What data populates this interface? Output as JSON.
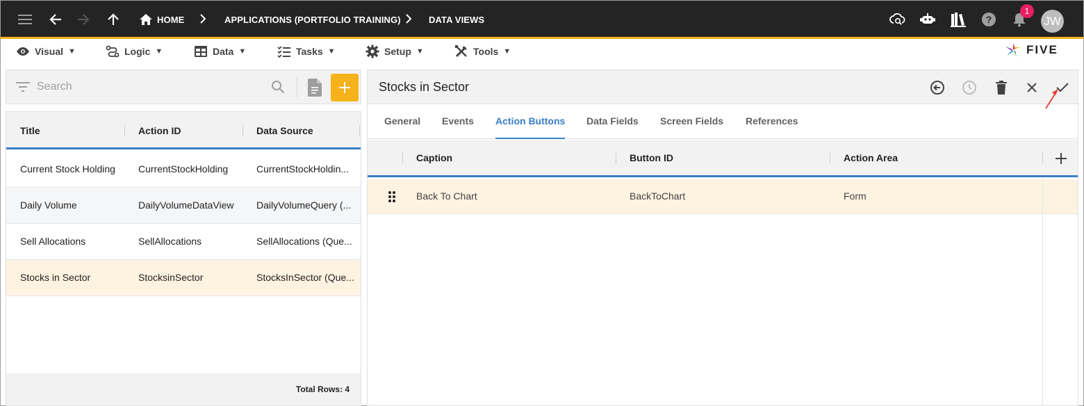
{
  "topbar": {
    "breadcrumbs": [
      "HOME",
      "APPLICATIONS (PORTFOLIO TRAINING)",
      "DATA VIEWS"
    ],
    "notification_count": "1",
    "avatar_initials": "JW"
  },
  "menu": {
    "items": [
      {
        "label": "Visual",
        "icon": "eye-icon"
      },
      {
        "label": "Logic",
        "icon": "logic-icon"
      },
      {
        "label": "Data",
        "icon": "table-icon"
      },
      {
        "label": "Tasks",
        "icon": "tasks-icon"
      },
      {
        "label": "Setup",
        "icon": "gear-icon"
      },
      {
        "label": "Tools",
        "icon": "tools-icon"
      }
    ],
    "logo_text": "FIVE"
  },
  "left": {
    "search_placeholder": "Search",
    "columns": [
      "Title",
      "Action ID",
      "Data Source"
    ],
    "rows": [
      {
        "title": "Current Stock Holding",
        "action_id": "CurrentStockHolding",
        "data_source": "CurrentStockHoldin..."
      },
      {
        "title": "Daily Volume",
        "action_id": "DailyVolumeDataView",
        "data_source": "DailyVolumeQuery (..."
      },
      {
        "title": "Sell Allocations",
        "action_id": "SellAllocations",
        "data_source": "SellAllocations (Que..."
      },
      {
        "title": "Stocks in Sector",
        "action_id": "StocksinSector",
        "data_source": "StocksInSector (Que..."
      }
    ],
    "footer": "Total Rows: 4"
  },
  "right": {
    "title": "Stocks in Sector",
    "tabs": [
      "General",
      "Events",
      "Action Buttons",
      "Data Fields",
      "Screen Fields",
      "References"
    ],
    "active_tab": "Action Buttons",
    "columns": [
      "Caption",
      "Button ID",
      "Action Area"
    ],
    "rows": [
      {
        "caption": "Back To Chart",
        "button_id": "BackToChart",
        "action_area": "Form"
      }
    ]
  },
  "colors": {
    "accent": "#3a7ec4",
    "brand_yellow": "#f5b21b",
    "topbar": "#242424",
    "selected_row": "#fdf3e1",
    "badge": "#e91e63"
  }
}
